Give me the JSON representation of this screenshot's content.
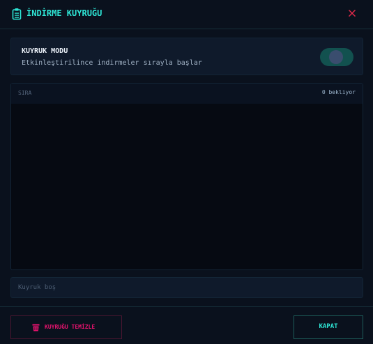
{
  "dialog": {
    "title": "İNDİRME KUYRUĞU",
    "title_icon": "clipboard-icon",
    "close_icon": "close-icon"
  },
  "mode": {
    "title": "KUYRUK MODU",
    "description": "Etkinleştirilince indirmeler sırayla başlar",
    "toggle_icon": "toggle-switch"
  },
  "queue": {
    "label": "SIRA",
    "count": "0 bekliyor",
    "empty_text": "Kuyruk boş"
  },
  "footer": {
    "clear_label": "KUYRUĞU TEMİZLE",
    "clear_icon": "trash-icon",
    "close_label": "KAPAT"
  },
  "colors": {
    "background": "#0a111d",
    "accent": "#2ee6d6",
    "danger": "#e8136e",
    "close_x": "#e0294a"
  }
}
